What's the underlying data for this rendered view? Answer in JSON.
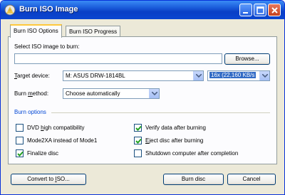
{
  "window": {
    "title": "Burn ISO Image"
  },
  "tabs": [
    {
      "label": "Burn ISO Options"
    },
    {
      "label": "Burn ISO Progress"
    }
  ],
  "iso": {
    "label": "Select ISO image to burn:",
    "value": "",
    "browse_label": "Browse..."
  },
  "target_device": {
    "label": "Target device:",
    "value": "M: ASUS DRW-1814BL",
    "speed": "16x (22,160 KB/s"
  },
  "burn_method": {
    "label": "Burn method:",
    "value": "Choose automatically"
  },
  "burn_options": {
    "title": "Burn options",
    "items": [
      {
        "label": "DVD high compatibility",
        "checked": false
      },
      {
        "label": "Mode2XA instead of Mode1",
        "checked": false
      },
      {
        "label": "Finalize disc",
        "checked": true
      },
      {
        "label": "Verify data after burning",
        "checked": true
      },
      {
        "label": "Eject disc after burning",
        "checked": true
      },
      {
        "label": "Shutdown computer after completion",
        "checked": false
      }
    ]
  },
  "buttons": {
    "convert": "Convert to ISO...",
    "burn": "Burn disc",
    "cancel": "Cancel"
  },
  "colors": {
    "title_bar": "#0a3fc6",
    "group_title": "#0046d5",
    "selection": "#316ac5"
  }
}
